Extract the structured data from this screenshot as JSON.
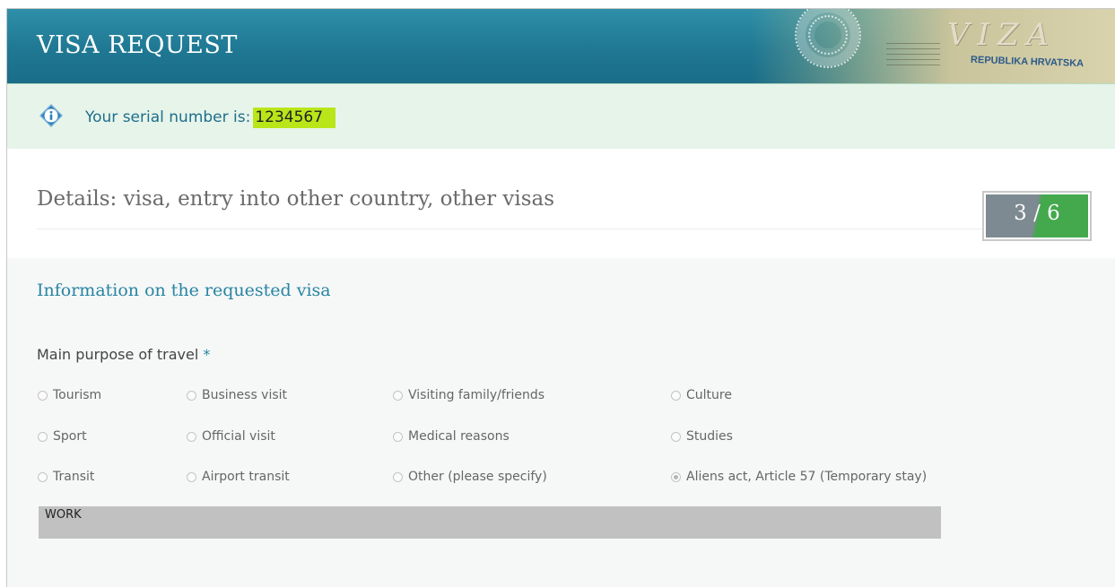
{
  "header": {
    "title": "VISA REQUEST",
    "art_word": "VIZA",
    "art_country": "REPUBLIKA HRVATSKA"
  },
  "info": {
    "icon": "info-icon",
    "message": "Your serial number is:",
    "serial_number": "1234567"
  },
  "details": {
    "title": "Details: visa, entry into other country, other visas",
    "step_label": "3 / 6",
    "step_progress": 0.5
  },
  "section": {
    "title": "Information on the requested visa"
  },
  "purpose": {
    "label": "Main purpose of travel",
    "required_mark": "*",
    "options": [
      {
        "label": "Tourism",
        "checked": false
      },
      {
        "label": "Business visit",
        "checked": false
      },
      {
        "label": "Visiting family/friends",
        "checked": false
      },
      {
        "label": "Culture",
        "checked": false
      },
      {
        "label": "Sport",
        "checked": false
      },
      {
        "label": "Official visit",
        "checked": false
      },
      {
        "label": "Medical reasons",
        "checked": false
      },
      {
        "label": "Studies",
        "checked": false
      },
      {
        "label": "Transit",
        "checked": false
      },
      {
        "label": "Airport transit",
        "checked": false
      },
      {
        "label": "Other (please specify)",
        "checked": false
      },
      {
        "label": "Aliens act, Article 57 (Temporary stay)",
        "checked": true
      }
    ],
    "specify_value": "WORK"
  },
  "colors": {
    "header": "#1f7893",
    "info_bg": "#e6f4ea",
    "serial_highlight": "#b9e619",
    "accent": "#2785a3",
    "step_done": "#44a84c",
    "step_remaining": "#7d8a92"
  }
}
